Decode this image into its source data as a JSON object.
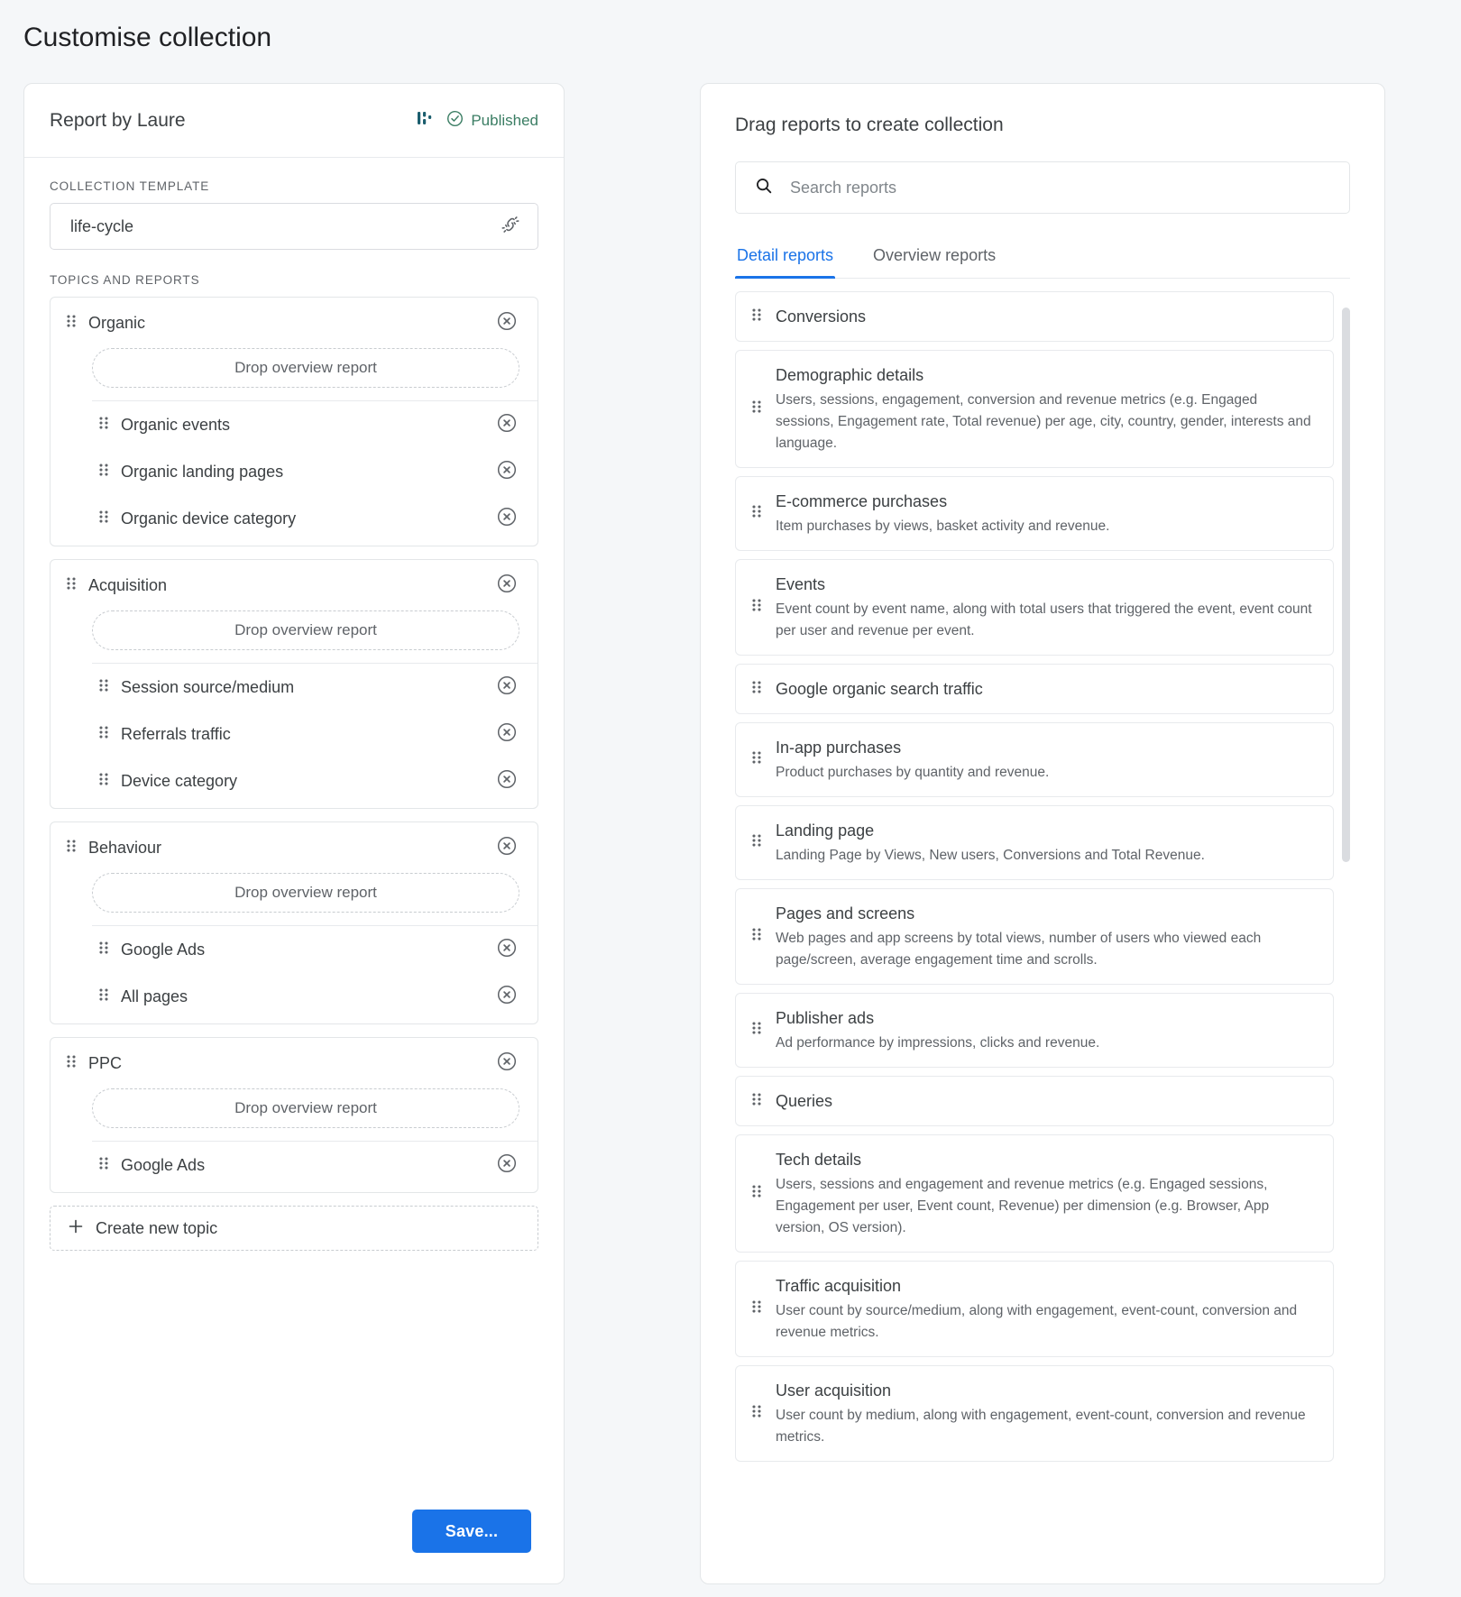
{
  "page": {
    "title": "Customise collection"
  },
  "left": {
    "header": {
      "title": "Report by Laure",
      "status": "Published",
      "analytics_icon": "analytics-bars-icon",
      "check_icon": "check-circle-icon"
    },
    "template_section": {
      "label": "Collection template",
      "value": "life-cycle",
      "action_icon": "unlink-icon"
    },
    "topics_label": "Topics and reports",
    "drop_placeholder": "Drop overview report",
    "topics": [
      {
        "name": "Organic",
        "reports": [
          "Organic events",
          "Organic landing pages",
          "Organic device category"
        ]
      },
      {
        "name": "Acquisition",
        "reports": [
          "Session source/medium",
          "Referrals traffic",
          "Device category"
        ]
      },
      {
        "name": "Behaviour",
        "reports": [
          "Google Ads",
          "All pages"
        ]
      },
      {
        "name": "PPC",
        "reports": [
          "Google Ads"
        ]
      }
    ],
    "create_topic_label": "Create new topic",
    "save_label": "Save..."
  },
  "right": {
    "title": "Drag reports to create collection",
    "search_placeholder": "Search reports",
    "search_value": "",
    "tabs": [
      {
        "label": "Detail reports",
        "active": true
      },
      {
        "label": "Overview reports",
        "active": false
      }
    ],
    "reports": [
      {
        "title": "Conversions",
        "desc": ""
      },
      {
        "title": "Demographic details",
        "desc": "Users, sessions, engagement, conversion and revenue metrics (e.g. Engaged sessions, Engagement rate, Total revenue) per age, city, country, gender, interests and language."
      },
      {
        "title": "E-commerce purchases",
        "desc": "Item purchases by views, basket activity and revenue."
      },
      {
        "title": "Events",
        "desc": "Event count by event name, along with total users that triggered the event, event count per user and revenue per event."
      },
      {
        "title": "Google organic search traffic",
        "desc": ""
      },
      {
        "title": "In-app purchases",
        "desc": "Product purchases by quantity and revenue."
      },
      {
        "title": "Landing page",
        "desc": "Landing Page by Views, New users, Conversions and Total Revenue."
      },
      {
        "title": "Pages and screens",
        "desc": "Web pages and app screens by total views, number of users who viewed each page/screen, average engagement time and scrolls."
      },
      {
        "title": "Publisher ads",
        "desc": "Ad performance by impressions, clicks and revenue."
      },
      {
        "title": "Queries",
        "desc": ""
      },
      {
        "title": "Tech details",
        "desc": "Users, sessions and engagement and revenue metrics (e.g. Engaged sessions, Engagement per user, Event count, Revenue) per dimension (e.g. Browser, App version, OS version)."
      },
      {
        "title": "Traffic acquisition",
        "desc": "User count by source/medium, along with engagement, event-count, conversion and revenue metrics."
      },
      {
        "title": "User acquisition",
        "desc": "User count by medium, along with engagement, event-count, conversion and revenue metrics."
      }
    ]
  },
  "colors": {
    "accent": "#1a73e8",
    "published_green": "#3a7d63",
    "analytics_teal": "#1b5e6e"
  }
}
